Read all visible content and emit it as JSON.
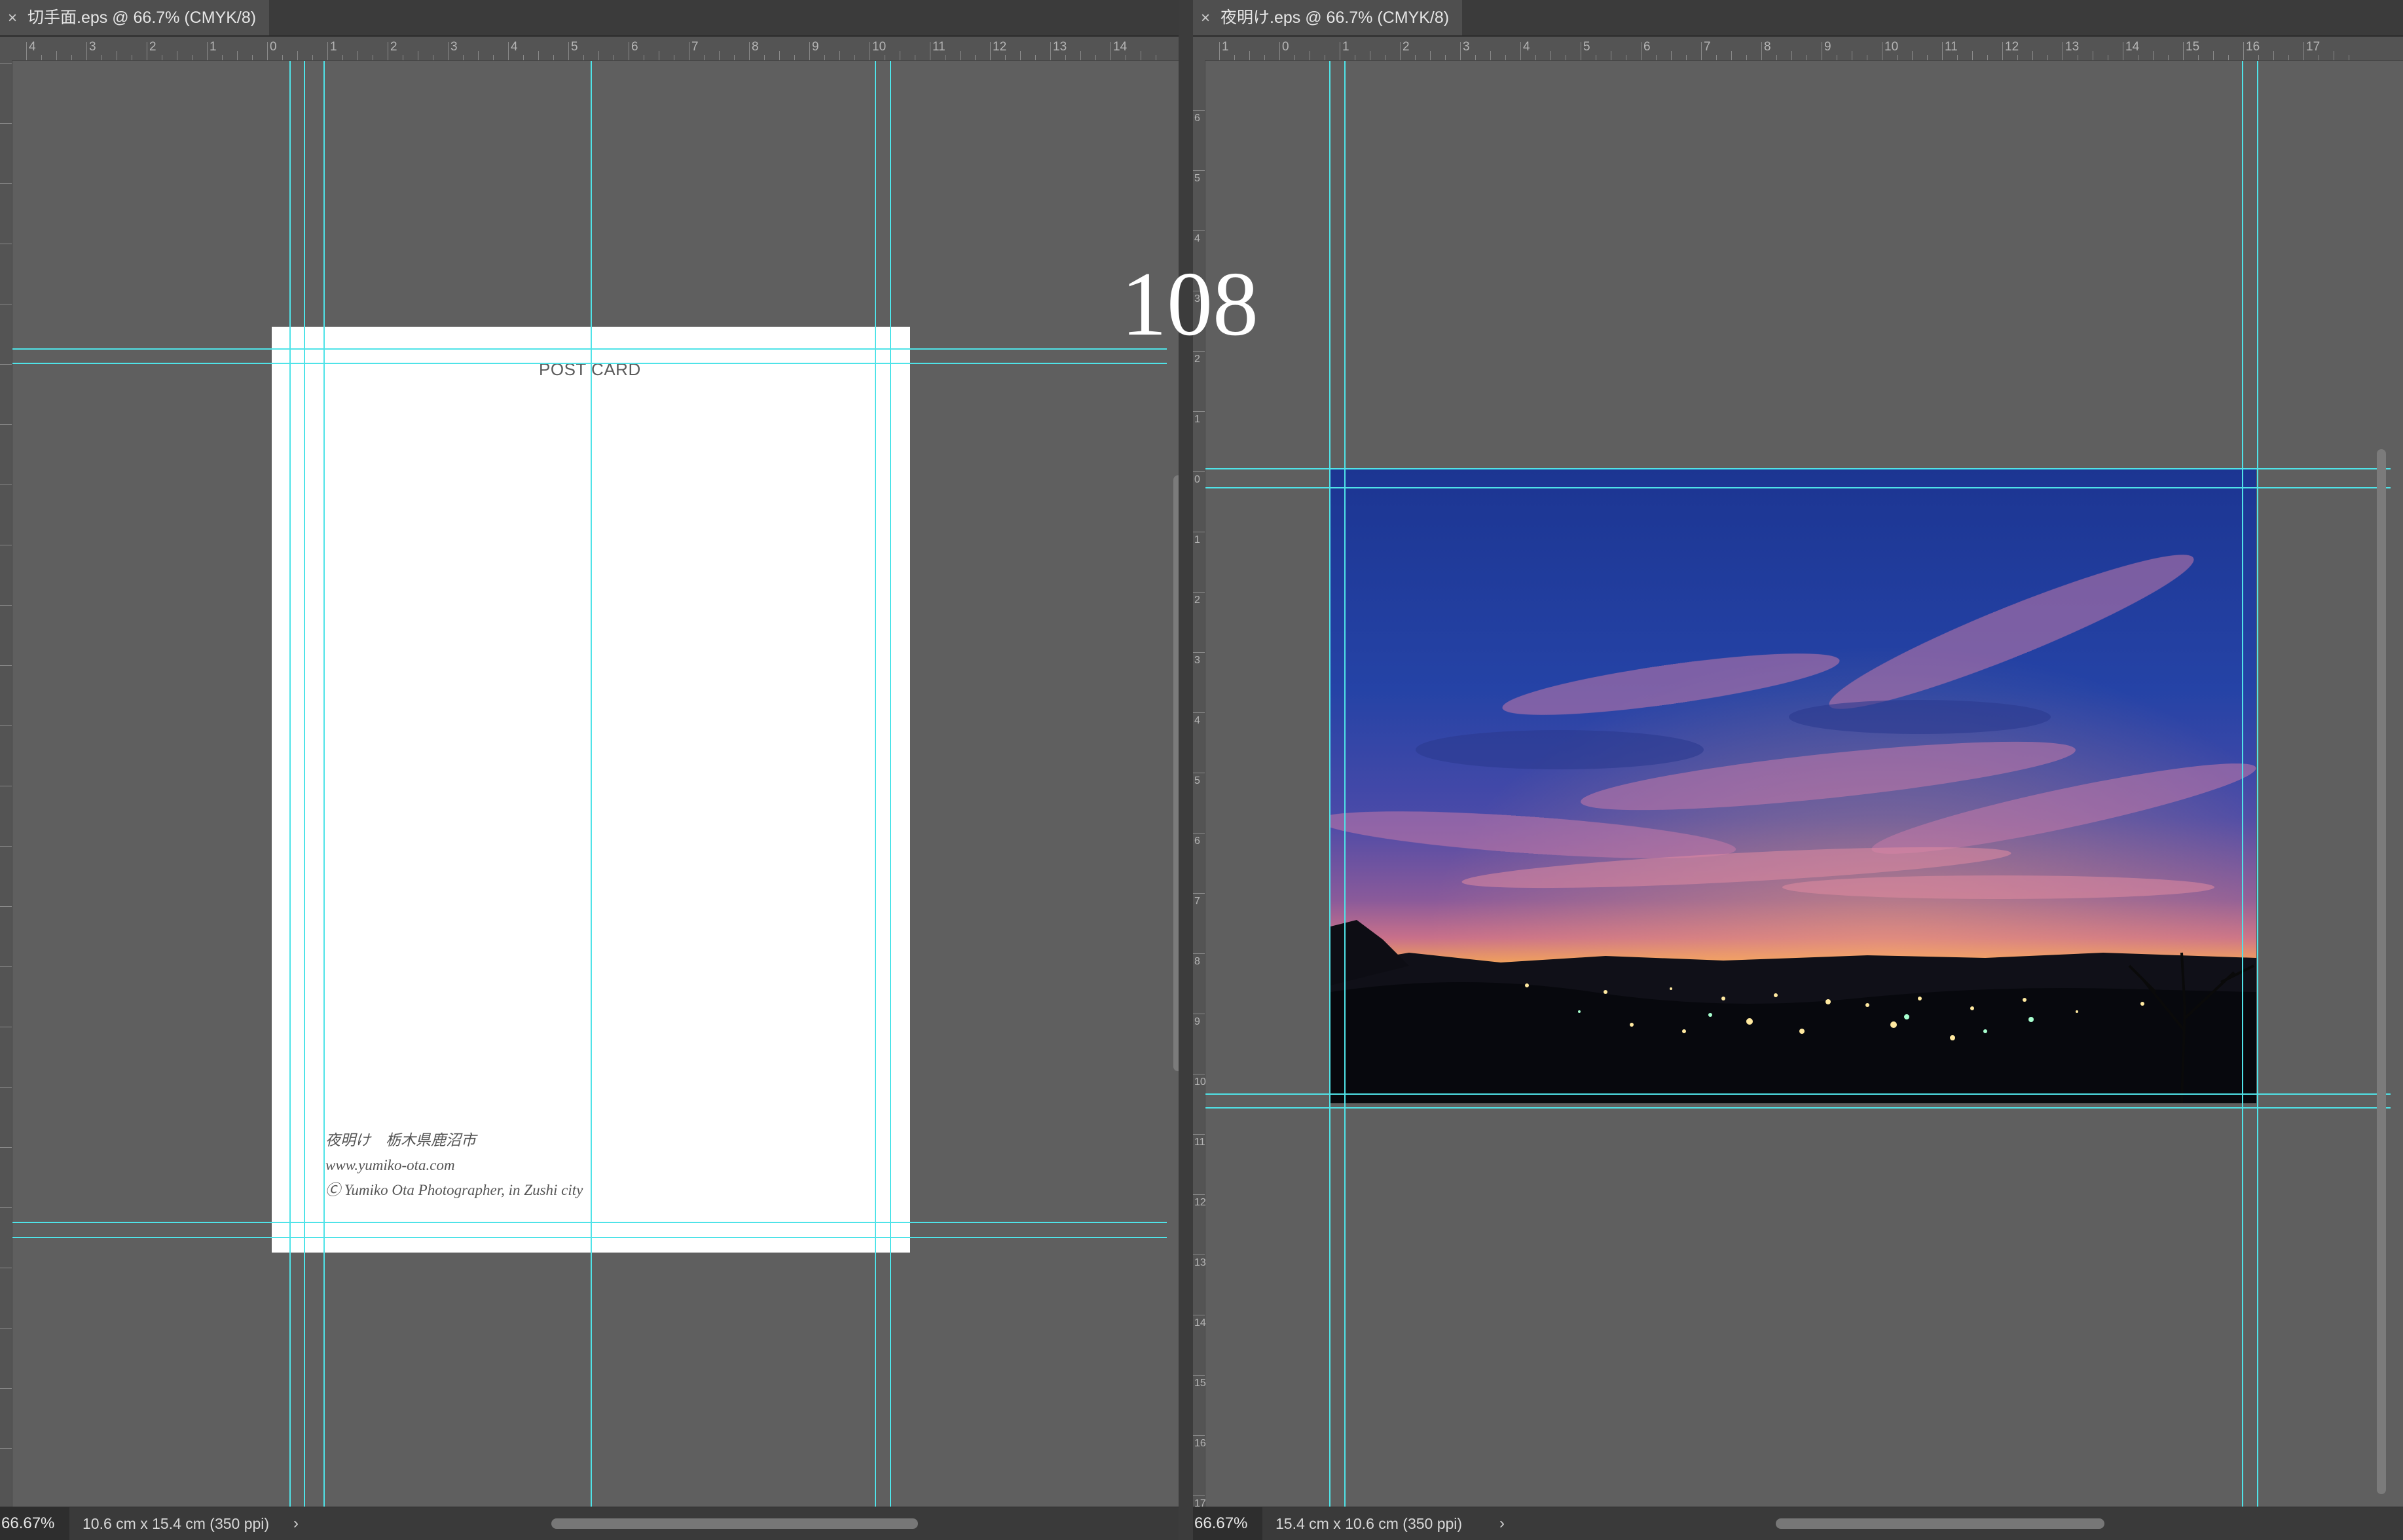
{
  "overlay_number": "108",
  "left_document": {
    "tab_title": "切手面.eps @ 66.7% (CMYK/8)",
    "ruler_top_labels": [
      "4",
      "3",
      "2",
      "1",
      "0",
      "1",
      "2",
      "3",
      "4",
      "5",
      "6",
      "7",
      "8",
      "9",
      "10",
      "11",
      "12",
      "13",
      "14"
    ],
    "postcard": {
      "title": "POST CARD",
      "credit_lines": [
        "夜明け　栃木県鹿沼市",
        "www.yumiko-ota.com",
        "Ⓒ Yumiko Ota Photographer, in Zushi city"
      ]
    },
    "status": {
      "zoom": "66.67%",
      "doc_info": "10.6 cm x 15.4 cm (350 ppi)",
      "arrow": "›"
    }
  },
  "right_document": {
    "tab_title": "夜明け.eps @ 66.7% (CMYK/8)",
    "ruler_top_labels": [
      "1",
      "0",
      "1",
      "2",
      "3",
      "4",
      "5",
      "6",
      "7",
      "8",
      "9",
      "10",
      "11",
      "12",
      "13",
      "14",
      "15",
      "16",
      "17"
    ],
    "ruler_left_labels": [
      "6",
      "5",
      "4",
      "3",
      "2",
      "1",
      "0",
      "1",
      "2",
      "3",
      "4",
      "5",
      "6",
      "7",
      "8",
      "9",
      "10",
      "11",
      "12",
      "13",
      "14",
      "15",
      "16",
      "17"
    ],
    "photo_description_icon": "night-cityscape-dawn-photo",
    "status": {
      "zoom": "66.67%",
      "doc_info": "15.4 cm x 10.6 cm (350 ppi)",
      "arrow": "›"
    }
  },
  "colors": {
    "guide": "#4fe3e8",
    "canvas": "#5f5f5f",
    "chrome": "#3b3b3b"
  }
}
